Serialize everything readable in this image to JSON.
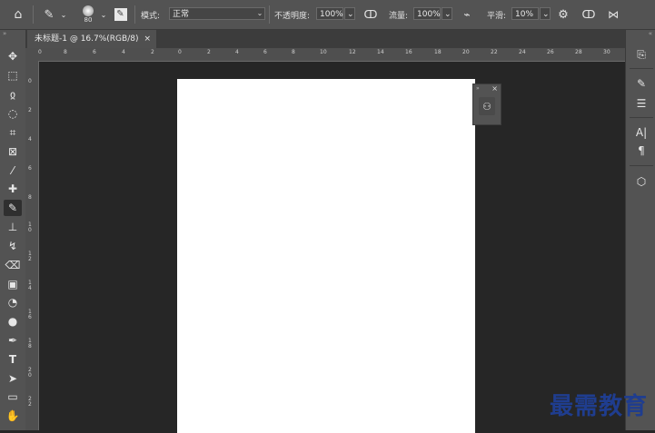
{
  "options_bar": {
    "brush_size": "80",
    "mode_label": "模式:",
    "mode_value": "正常",
    "opacity_label": "不透明度:",
    "opacity_value": "100%",
    "flow_label": "流量:",
    "flow_value": "100%",
    "smoothing_label": "平滑:",
    "smoothing_value": "10%"
  },
  "document_tab": {
    "title": "未标题-1 @ 16.7%(RGB/8)",
    "close": "×"
  },
  "rulers": {
    "horizontal": [
      "0",
      "8",
      "6",
      "4",
      "2",
      "0",
      "2",
      "4",
      "6",
      "8",
      "10",
      "12",
      "14",
      "16",
      "18",
      "20",
      "22",
      "24",
      "26",
      "28",
      "30"
    ],
    "vertical": [
      "0",
      "2",
      "4",
      "6",
      "8",
      "1\n0",
      "1\n2",
      "1\n4",
      "1\n6",
      "1\n8",
      "2\n0",
      "2\n2"
    ]
  },
  "watermark": "最需教育",
  "icons": {
    "home": "home-icon",
    "brush": "brush-icon",
    "settings": "gear-icon",
    "pressure": "pressure-icon",
    "symmetry": "butterfly-icon"
  }
}
